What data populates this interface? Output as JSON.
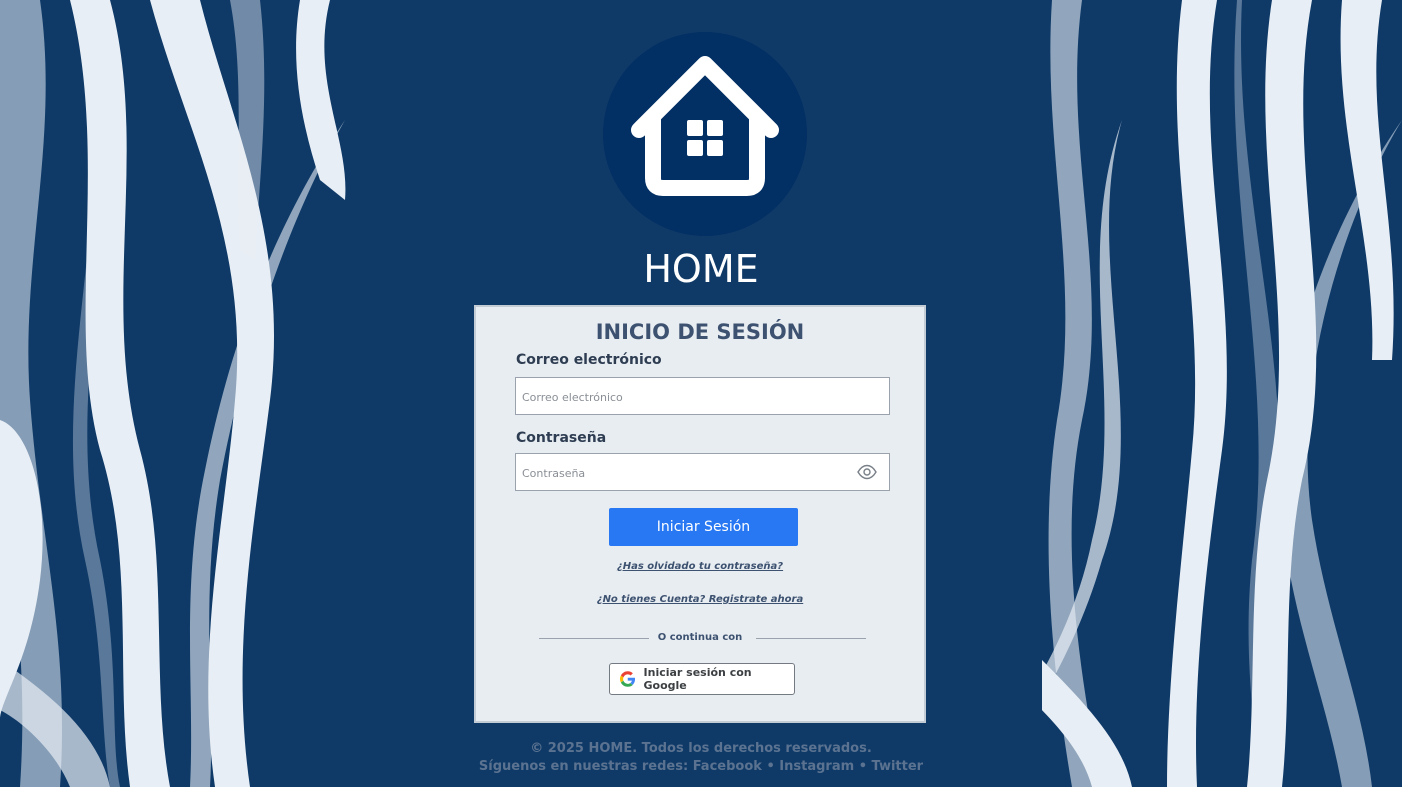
{
  "brand": {
    "name": "HOME",
    "logo_icon": "house-icon",
    "circle_color": "#022f64"
  },
  "login": {
    "title": "INICIO DE SESIÓN",
    "email_label": "Correo electrónico",
    "email_placeholder": "Correo electrónico",
    "email_value": "",
    "password_label": "Contraseña",
    "password_placeholder": "Contraseña",
    "password_value": "",
    "password_toggle_icon": "eye-icon",
    "submit_label": "Iniciar Sesión",
    "forgot_link": "¿Has olvidado tu contraseña?",
    "register_link": "¿No tienes Cuenta? Registrate ahora",
    "divider_text": "O continua con",
    "google_button_label": "Iniciar sesión con Google",
    "google_icon": "google-icon"
  },
  "footer": {
    "copyright": "© 2025 HOME. Todos los derechos reservados.",
    "social_prefix": "Síguenos en nuestras redes:",
    "social_links": [
      "Facebook",
      "Instagram",
      "Twitter"
    ],
    "separator": "•"
  },
  "colors": {
    "background": "#0f3a68",
    "card": "#e8edf2",
    "primary": "#2778f2",
    "title_text": "#3d5270"
  }
}
